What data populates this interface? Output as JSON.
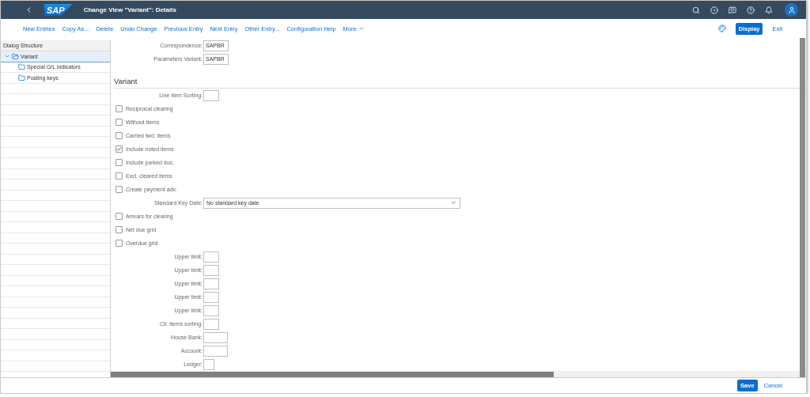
{
  "shell": {
    "title": "Change View \"Variant\": Details",
    "logo": "SAP"
  },
  "toolbar": {
    "actions": [
      {
        "label": "New Entries"
      },
      {
        "label": "Copy As..."
      },
      {
        "label": "Delete"
      },
      {
        "label": "Undo Change"
      },
      {
        "label": "Previous Entry"
      },
      {
        "label": "Next Entry"
      },
      {
        "label": "Other Entry..."
      },
      {
        "label": "Configuration Help"
      }
    ],
    "more": "More",
    "primary": "Display",
    "exit": "Exit"
  },
  "dialog_structure": {
    "title": "Dialog Structure",
    "tree": [
      {
        "label": "Variant",
        "expanded": true,
        "selected": true,
        "children": [
          {
            "label": "Special G/L indicators",
            "selected": false
          },
          {
            "label": "Posting keys",
            "selected": false
          }
        ]
      }
    ]
  },
  "header_fields": [
    {
      "label": "Correspondence:",
      "value": "SAPBR"
    },
    {
      "label": "Parameters Variant:",
      "value": "SAPBR"
    }
  ],
  "section": {
    "title": "Variant",
    "rows": [
      {
        "kind": "field",
        "label": "Line Item Sorting:"
      },
      {
        "kind": "checkbox",
        "label": "Reciprocal clearing",
        "checked": false
      },
      {
        "kind": "checkbox",
        "label": "Without items",
        "checked": false
      },
      {
        "kind": "checkbox",
        "label": "Carried fwd. items",
        "checked": false
      },
      {
        "kind": "checkbox",
        "label": "Include noted items",
        "checked": true
      },
      {
        "kind": "checkbox",
        "label": "Include parked doc.",
        "checked": false
      },
      {
        "kind": "checkbox",
        "label": "Excl. cleared items",
        "checked": false
      },
      {
        "kind": "checkbox",
        "label": "Create payment adv.",
        "checked": false
      },
      {
        "kind": "select",
        "label": "Standard Key Date:",
        "value": "No standard key date"
      },
      {
        "kind": "checkbox",
        "label": "Arrears for clearing",
        "checked": false
      },
      {
        "kind": "checkbox",
        "label": "Net due grid",
        "checked": false
      },
      {
        "kind": "checkbox",
        "label": "Overdue grid",
        "checked": false
      },
      {
        "kind": "field",
        "label": "Upper limit:"
      },
      {
        "kind": "field",
        "label": "Upper limit:"
      },
      {
        "kind": "field",
        "label": "Upper limit:"
      },
      {
        "kind": "field",
        "label": "Upper limit:"
      },
      {
        "kind": "field",
        "label": "Upper limit:"
      },
      {
        "kind": "field",
        "label": "Clr. items sorting:"
      },
      {
        "kind": "wide-field",
        "label": "House Bank:"
      },
      {
        "kind": "wide-field",
        "label": "Account:"
      },
      {
        "kind": "narrow-field",
        "label": "Ledger:"
      }
    ]
  },
  "footer": {
    "save": "Save",
    "cancel": "Cancel"
  }
}
